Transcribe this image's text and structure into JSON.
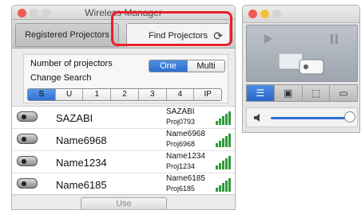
{
  "window": {
    "title": "Wireless Manager"
  },
  "tabs": {
    "registered_label": "Registered Projectors",
    "find_label": "Find Projectors"
  },
  "settings": {
    "number_label": "Number of projectors",
    "one_label": "One",
    "multi_label": "Multi",
    "change_search_label": "Change Search",
    "search_options": [
      "S",
      "U",
      "1",
      "2",
      "3",
      "4",
      "IP"
    ],
    "selected_option": "S"
  },
  "projectors": [
    {
      "name": "SAZABI",
      "sub_name": "SAZABI",
      "sub_id": "Proj0793"
    },
    {
      "name": "Name6968",
      "sub_name": "Name6968",
      "sub_id": "Proj6968"
    },
    {
      "name": "Name1234",
      "sub_name": "Name1234",
      "sub_id": "Proj1234"
    },
    {
      "name": "Name6185",
      "sub_name": "Name6185",
      "sub_id": "Proj6185"
    }
  ],
  "actions": {
    "use_label": "Use"
  },
  "colors": {
    "accent_blue": "#2b6ed1",
    "highlight_red": "#e8202a",
    "signal_green": "#2e9b3b"
  }
}
